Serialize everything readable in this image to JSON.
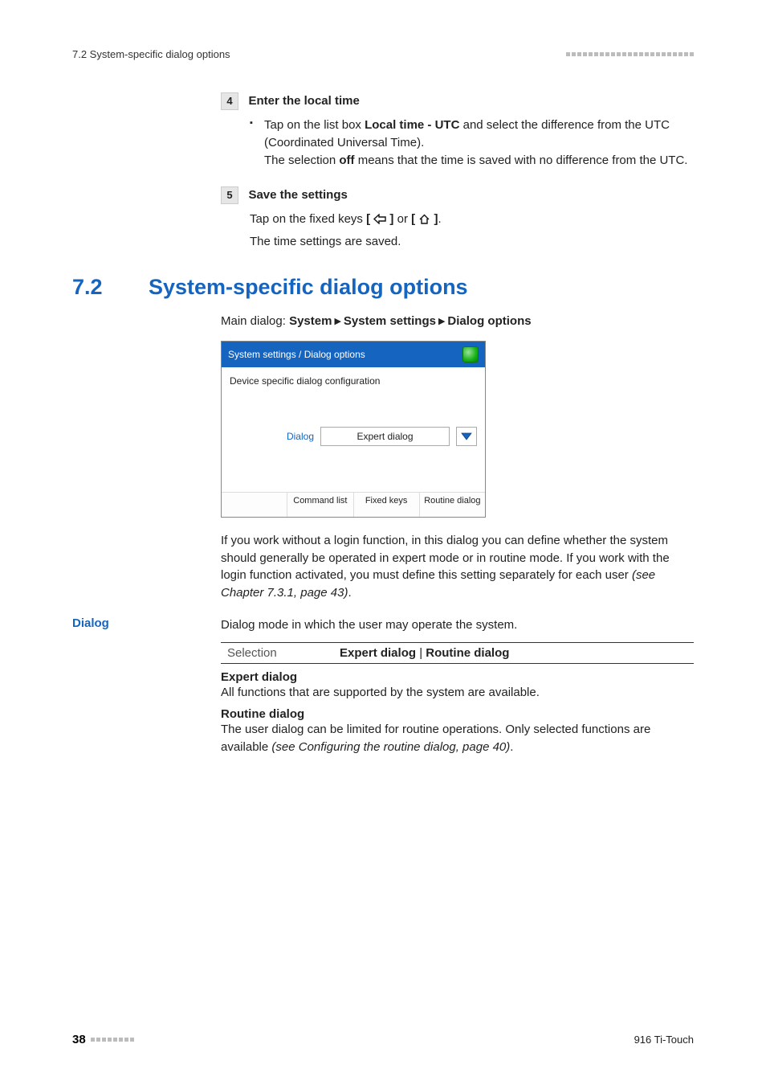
{
  "header": {
    "left": "7.2 System-specific dialog options"
  },
  "step4": {
    "num": "4",
    "title": "Enter the local time",
    "bullet_pre": "Tap on the list box ",
    "bullet_bold": "Local time - UTC",
    "bullet_post": " and select the difference from the UTC (Coordinated Universal Time).",
    "line2_pre": "The selection ",
    "line2_bold": "off",
    "line2_post": " means that the time is saved with no difference from the UTC."
  },
  "step5": {
    "num": "5",
    "title": "Save the settings",
    "line1_pre": "Tap on the fixed keys ",
    "line1_mid": " or ",
    "line1_post": ".",
    "line2": "The time settings are saved."
  },
  "h2": {
    "num": "7.2",
    "text": "System-specific dialog options"
  },
  "breadcrumb": {
    "prefix": "Main dialog: ",
    "a": "System",
    "b": "System settings",
    "c": "Dialog options"
  },
  "screenshot": {
    "title": "System settings / Dialog options",
    "config": "Device specific dialog configuration",
    "dlabel": "Dialog",
    "dvalue": "Expert dialog",
    "btn_spacer": "",
    "btn1": "Command list",
    "btn2": "Fixed keys",
    "btn3": "Routine dialog"
  },
  "para1_pre": "If you work without a login function, in this dialog you can define whether the system should generally be operated in expert mode or in routine mode. If you work with the login function activated, you must define this setting separately for each user ",
  "para1_ital": "(see Chapter 7.3.1, page 43)",
  "para1_post": ".",
  "dialog_section": {
    "sidehead": "Dialog",
    "intro": "Dialog mode in which the user may operate the system.",
    "sel_label": "Selection",
    "sel_a": "Expert dialog",
    "sel_sep": " | ",
    "sel_b": "Routine dialog",
    "exp_head": "Expert dialog",
    "exp_text": "All functions that are supported by the system are available.",
    "rou_head": "Routine dialog",
    "rou_text_pre": "The user dialog can be limited for routine operations. Only selected functions are available ",
    "rou_text_ital": "(see Configuring the routine dialog, page 40)",
    "rou_text_post": "."
  },
  "footer": {
    "page": "38",
    "product": "916 Ti-Touch"
  }
}
